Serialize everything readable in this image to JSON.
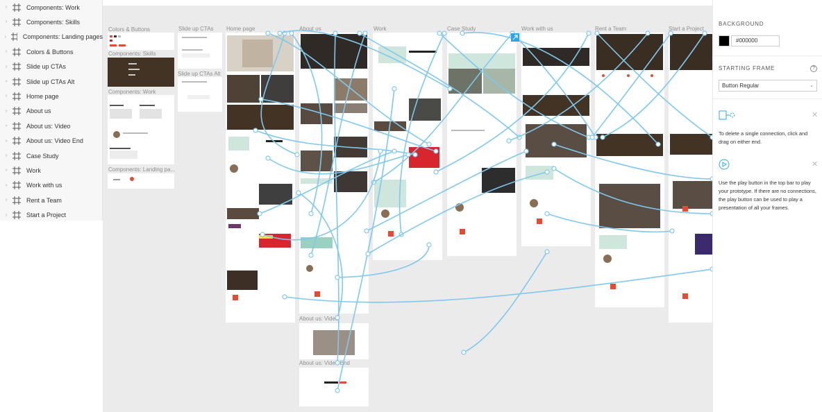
{
  "layers": [
    "Components: Work",
    "Components: Skills",
    "Components: Landing pages",
    "Colors & Buttons",
    "Slide up CTAs",
    "Slide up CTAs Alt",
    "Home page",
    "About us",
    "About us: Video",
    "About us: Video End",
    "Case Study",
    "Work",
    "Work with us",
    "Rent a Team",
    "Start a Project"
  ],
  "canvas": {
    "frame_titles": {
      "colors_buttons": "Colors & Buttons",
      "slide_up_ctas": "Slide up CTAs",
      "home_page": "Home page",
      "about_us": "About us",
      "work": "Work",
      "case_study": "Case Study",
      "work_with_us": "Work with us",
      "rent_a_team": "Rent a Team",
      "start_a_project": "Start a Project",
      "components_skills": "Components: Skills",
      "components_work": "Components: Work",
      "components_landing": "Components: Landing pa...",
      "slide_up_ctas_alt": "Slide up CTAs Alt",
      "about_us_video": "About us: Video",
      "about_us_video_end": "About us: Video End"
    },
    "connector_color": "#7fc8ee",
    "selection_color": "#2ea6e6"
  },
  "props": {
    "background_title": "BACKGROUND",
    "background_hex": "#000000",
    "background_color": "#000000",
    "starting_frame_title": "STARTING FRAME",
    "help_icon": "?",
    "starting_frame_value": "Button Regular",
    "tip_delete": "To delete a single connection, click and drag on either end.",
    "tip_play": "Use the play button in the top bar to play your prototype. If there are no connections, the play button can be used to play a presentation of all your frames.",
    "close_glyph": "✕"
  }
}
